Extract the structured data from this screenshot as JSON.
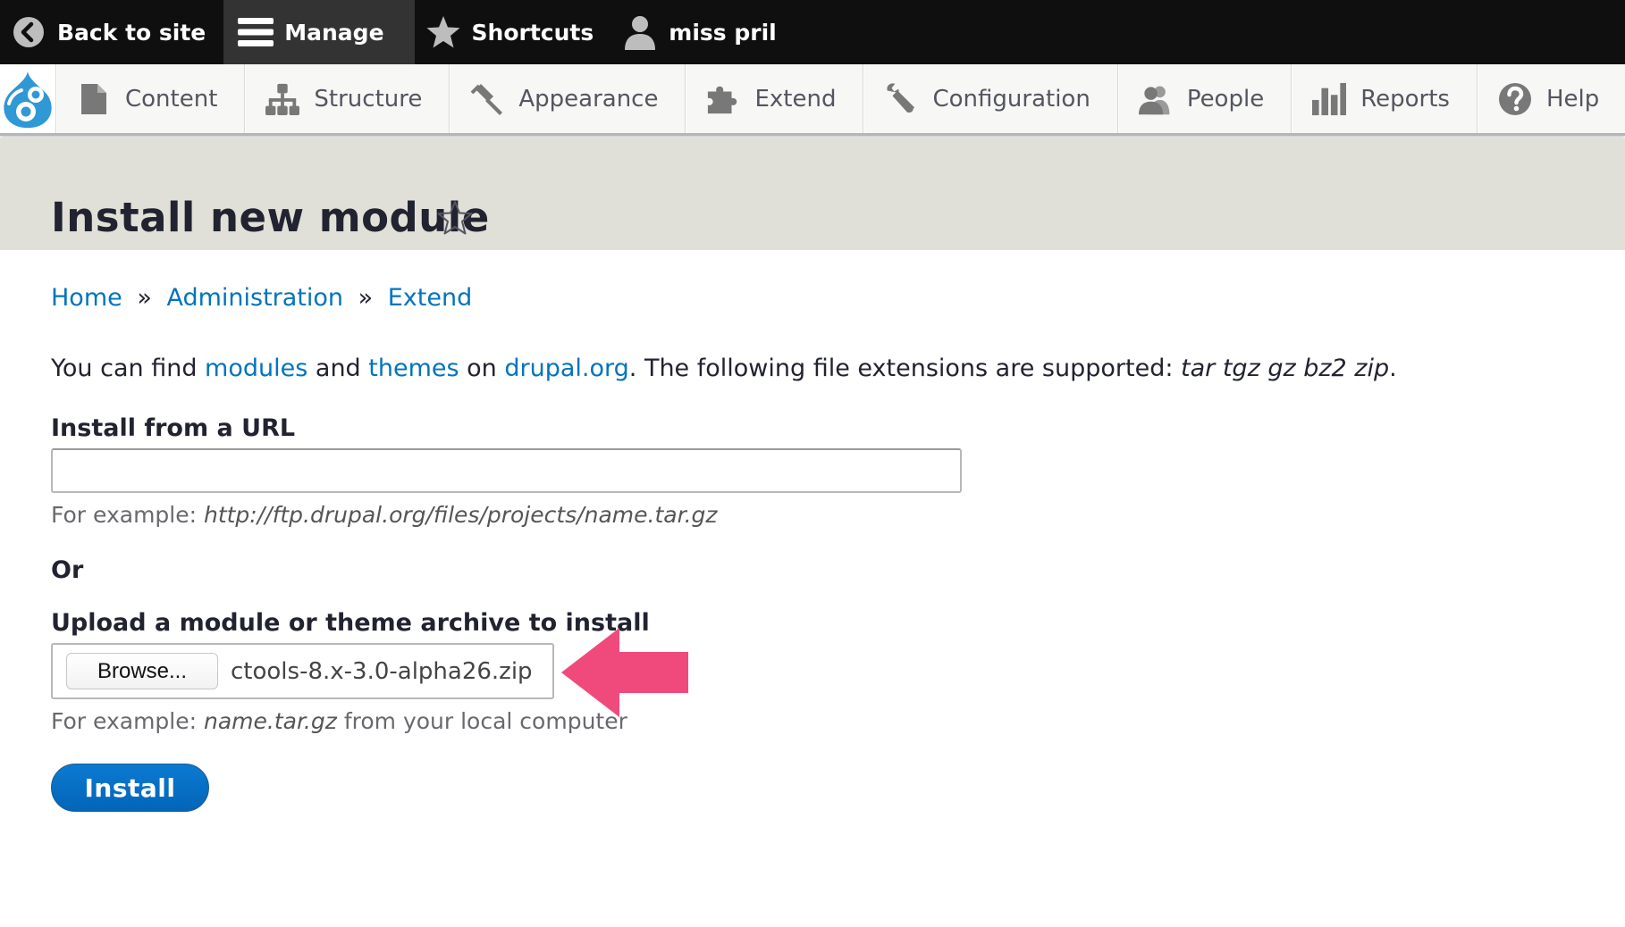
{
  "toolbar": {
    "back_label": "Back to site",
    "manage_label": "Manage",
    "shortcuts_label": "Shortcuts",
    "user_label": "miss pril"
  },
  "tray": {
    "items": [
      {
        "label": "Content",
        "icon": "content-icon"
      },
      {
        "label": "Structure",
        "icon": "structure-icon"
      },
      {
        "label": "Appearance",
        "icon": "appearance-icon"
      },
      {
        "label": "Extend",
        "icon": "extend-icon"
      },
      {
        "label": "Configuration",
        "icon": "configuration-icon"
      },
      {
        "label": "People",
        "icon": "people-icon"
      },
      {
        "label": "Reports",
        "icon": "reports-icon"
      },
      {
        "label": "Help",
        "icon": "help-icon"
      }
    ]
  },
  "page": {
    "title": "Install new module"
  },
  "breadcrumb": {
    "home": "Home",
    "sep": "»",
    "administration": "Administration",
    "extend": "Extend"
  },
  "help": {
    "prefix": "You can find ",
    "modules_link": "modules",
    "and": " and ",
    "themes_link": "themes",
    "on": " on ",
    "drupal_link": "drupal.org",
    "suffix": ". The following file extensions are supported: ",
    "extensions": "tar tgz gz bz2 zip",
    "end": "."
  },
  "form": {
    "url_label": "Install from a URL",
    "url_value": "",
    "url_desc_prefix": "For example: ",
    "url_desc_example": "http://ftp.drupal.org/files/projects/name.tar.gz",
    "or_label": "Or",
    "upload_label": "Upload a module or theme archive to install",
    "browse_label": "Browse...",
    "file_name": "ctools-8.x-3.0-alpha26.zip",
    "upload_desc_prefix": "For example: ",
    "upload_desc_example": "name.tar.gz",
    "upload_desc_suffix": " from your local computer",
    "install_label": "Install"
  },
  "colors": {
    "toolbar_bg": "#0f0f0f",
    "link": "#0074bd",
    "primary_button": "#0074bd",
    "arrow": "#f04a7c",
    "header_bg": "#e0e0d8"
  }
}
